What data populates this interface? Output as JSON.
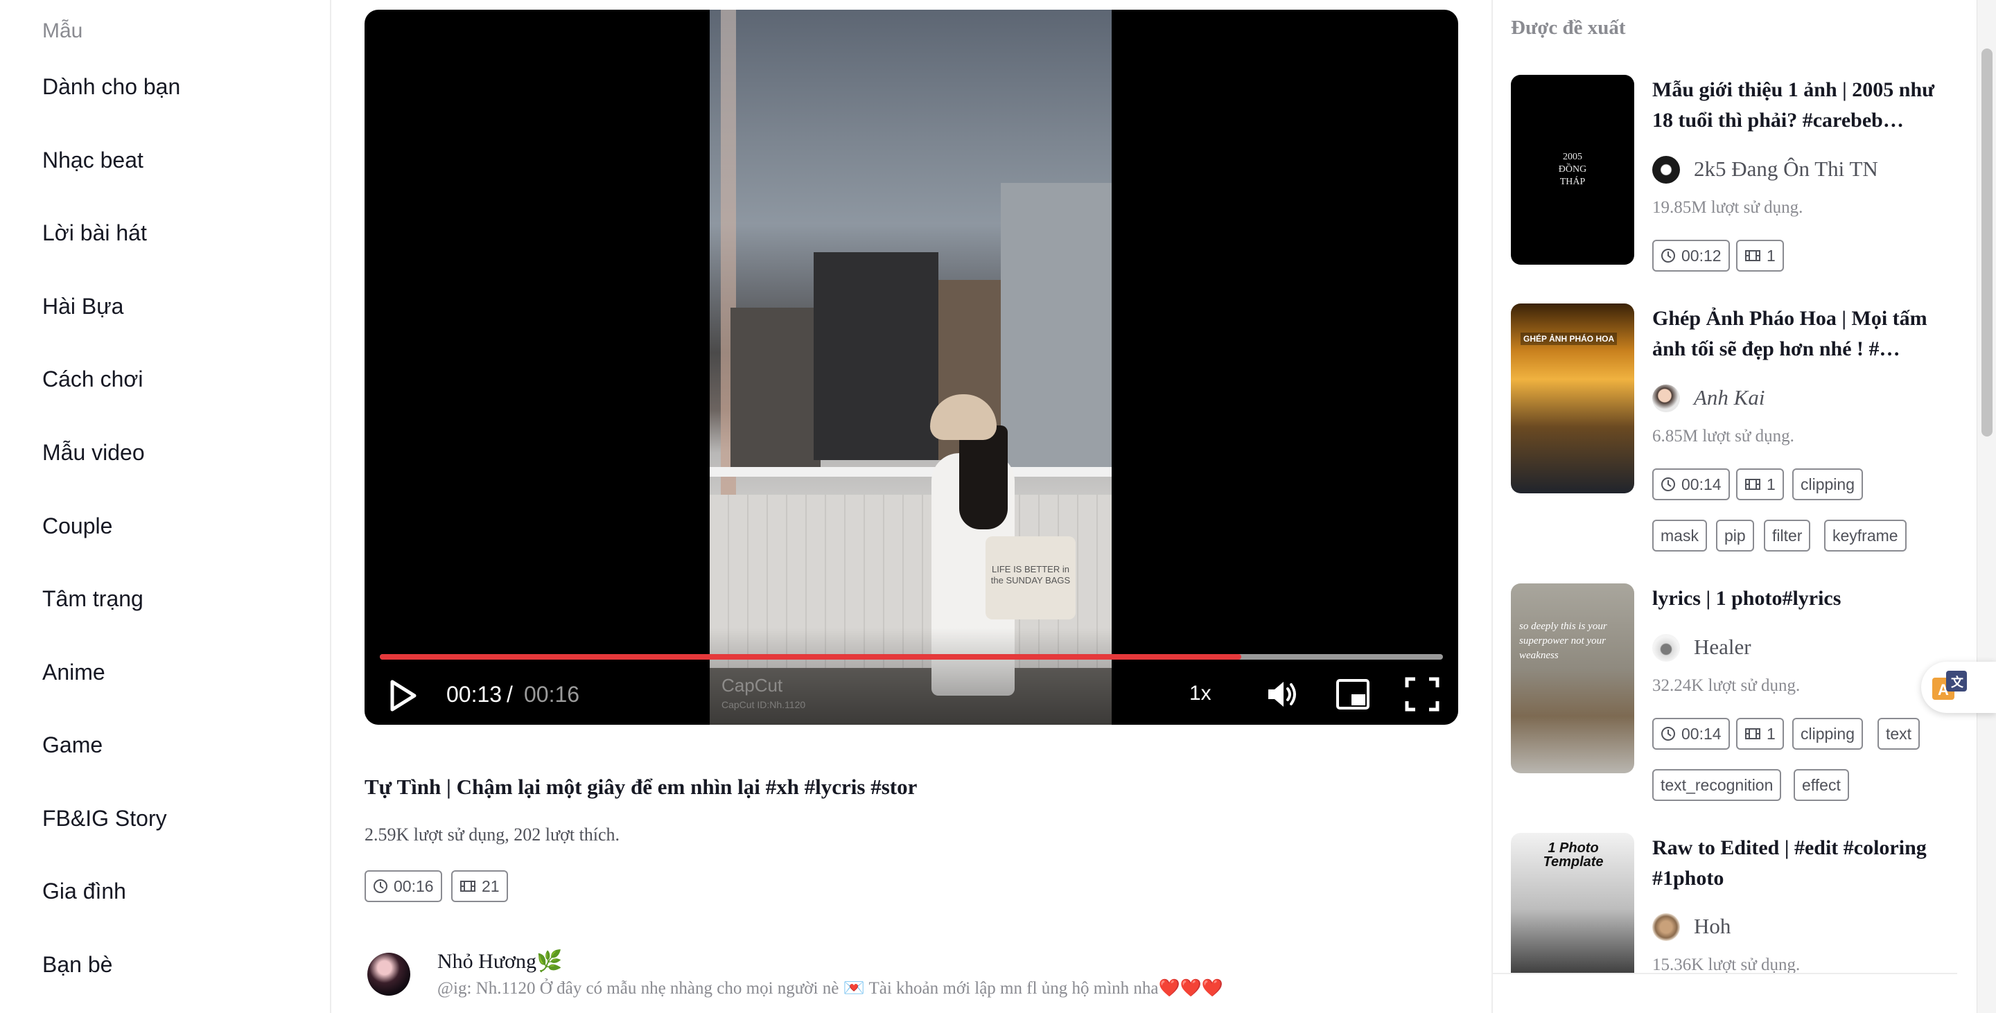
{
  "sidebar": {
    "heading": "Mẫu",
    "items": [
      {
        "label": "Dành cho bạn"
      },
      {
        "label": "Nhạc beat"
      },
      {
        "label": "Lời bài hát"
      },
      {
        "label": "Hài Bựa"
      },
      {
        "label": "Cách chơi"
      },
      {
        "label": "Mẫu video"
      },
      {
        "label": "Couple"
      },
      {
        "label": "Tâm trạng"
      },
      {
        "label": "Anime"
      },
      {
        "label": "Game"
      },
      {
        "label": "FB&IG Story"
      },
      {
        "label": "Gia đình"
      },
      {
        "label": "Bạn bè"
      }
    ]
  },
  "player": {
    "current_time": "00:13",
    "separator": "/",
    "total_time": "00:16",
    "progress_fraction": 0.81,
    "speed": "1x",
    "watermark": "CapCut",
    "watermark_id": "CapCut ID:Nh.1120",
    "bag_text": "LIFE IS BETTER in the SUNDAY BAGS",
    "accent_color": "#e5393b",
    "icons": [
      "play-icon",
      "volume-icon",
      "picture-in-picture-icon",
      "fullscreen-icon"
    ]
  },
  "template": {
    "title": "Tự Tình | Chậm lại một giây để em nhìn lại #xh #lycris #stor",
    "stats": "2.59K lượt sử dụng, 202 lượt thích.",
    "duration": "00:16",
    "clips": "21"
  },
  "author": {
    "name": "Nhỏ Hương🌿",
    "description": "@ig: Nh.1120 Ở đây có mẫu nhẹ nhàng cho mọi người nè 💌 Tài khoản mới lập mn fl ủng hộ mình nha❤️❤️❤️"
  },
  "recommended": {
    "heading": "Được đề xuất",
    "cards": [
      {
        "title": "Mẫu giới thiệu 1 ảnh | 2005 như 18 tuổi thì phải? #carebeb…",
        "creator": "2k5 Đang Ôn Thi TN",
        "usage": "19.85M lượt sử dụng.",
        "duration": "00:12",
        "clips": "1",
        "tags": [],
        "thumb_text": "2005 ĐỒNG THÁP"
      },
      {
        "title": "Ghép Ảnh Pháo Hoa | Mọi tấm ảnh tối sẽ đẹp hơn nhé ! #…",
        "creator": "Anh Kai",
        "usage": "6.85M lượt sử dụng.",
        "duration": "00:14",
        "clips": "1",
        "tags": [
          "clipping",
          "mask",
          "pip",
          "filter",
          "keyframe"
        ],
        "thumb_text": "GHÉP ẢNH PHÁO HOA"
      },
      {
        "title": "lyrics | 1 photo#lyrics",
        "creator": "Healer",
        "usage": "32.24K lượt sử dụng.",
        "duration": "00:14",
        "clips": "1",
        "tags": [
          "clipping",
          "text",
          "text_recognition",
          "effect"
        ],
        "thumb_text": "so deeply this is your superpower not your weakness"
      },
      {
        "title": "Raw to Edited | #edit #coloring #1photo",
        "creator": "Hoh",
        "usage": "15.36K lượt sử dụng.",
        "duration": "",
        "clips": "",
        "tags": [],
        "thumb_text": "1 Photo Template"
      }
    ]
  }
}
